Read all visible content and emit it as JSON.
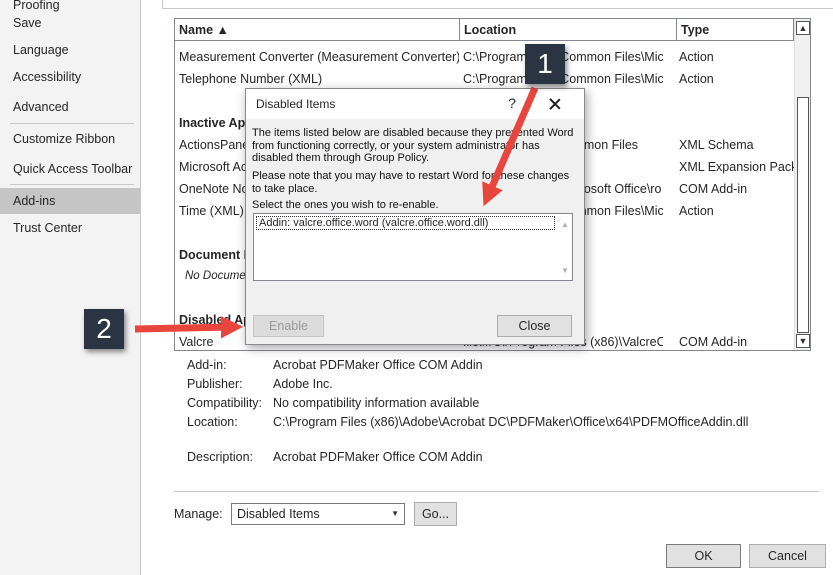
{
  "nav": {
    "items": [
      {
        "label": "Proofing"
      },
      {
        "label": "Save"
      },
      {
        "label": "Language"
      },
      {
        "label": "Accessibility"
      },
      {
        "label": "Advanced"
      },
      {
        "label": "Customize Ribbon"
      },
      {
        "label": "Quick Access Toolbar"
      },
      {
        "label": "Add-ins"
      },
      {
        "label": "Trust Center"
      }
    ],
    "selected": "Add-ins"
  },
  "addins_table": {
    "columns": [
      "Name ▲",
      "Location",
      "Type"
    ],
    "rows": [
      {
        "name": "Measurement Converter (Measurement Converter)",
        "location": "C:\\Program Files\\Common Files\\Micr",
        "type": "Action"
      },
      {
        "name": "Telephone Number (XML)",
        "location": "C:\\Program Files\\Common Files\\Micr",
        "type": "Action"
      }
    ],
    "inactive_group": "Inactive Application Add-ins",
    "inactive_rows": [
      {
        "name": "ActionsPane Schema for Add-Ins",
        "location": "c:\\Program Files\\Common Files",
        "type": "XML Schema"
      },
      {
        "name": "Microsoft Actions Pane 3",
        "location": "",
        "type": "XML Expansion Pack"
      },
      {
        "name": "OneNote Notes about Word Documents",
        "location": "C:\\Program Files\\Microsoft Office\\ro",
        "type": "COM Add-in"
      },
      {
        "name": "Time (XML)",
        "location": "C:\\Program Files\\Common Files\\Micr",
        "type": "Action"
      }
    ],
    "document_group": "Document Related Add-ins",
    "no_document_note": "No Document Related Add-ins",
    "disabled_group": "Disabled Application Add-ins",
    "disabled_rows": [
      {
        "name": "Valcre",
        "location": "file:///C:/Program Files (x86)\\ValcreOf",
        "type": "COM Add-in"
      }
    ]
  },
  "details": {
    "addin_label": "Add-in:",
    "addin_value": "Acrobat PDFMaker Office COM Addin",
    "publisher_label": "Publisher:",
    "publisher_value": "Adobe Inc.",
    "compat_label": "Compatibility:",
    "compat_value": "No compatibility information available",
    "location_label": "Location:",
    "location_value": "C:\\Program Files (x86)\\Adobe\\Acrobat DC\\PDFMaker\\Office\\x64\\PDFMOfficeAddin.dll",
    "description_label": "Description:",
    "description_value": "Acrobat PDFMaker Office COM Addin"
  },
  "manage": {
    "label": "Manage:",
    "selected": "Disabled Items",
    "go_label": "Go..."
  },
  "footer": {
    "ok_label": "OK",
    "cancel_label": "Cancel"
  },
  "dialog": {
    "title": "Disabled Items",
    "help_glyph": "?",
    "text1": "The items listed below are disabled because they prevented Word from functioning correctly, or your system administrator has disabled them through Group Policy.",
    "text2": "Please note that you may have to restart Word for these changes to take place.",
    "text3": "Select the ones you wish to re-enable.",
    "item": "Addin: valcre.office.word (valcre.office.word.dll)",
    "enable_label": "Enable",
    "close_label": "Close"
  },
  "callouts": {
    "one": "1",
    "two": "2"
  },
  "colors": {
    "callout_bg": "#2b3442",
    "arrow": "#e8453c",
    "nav_selected": "#c5c5c5"
  }
}
